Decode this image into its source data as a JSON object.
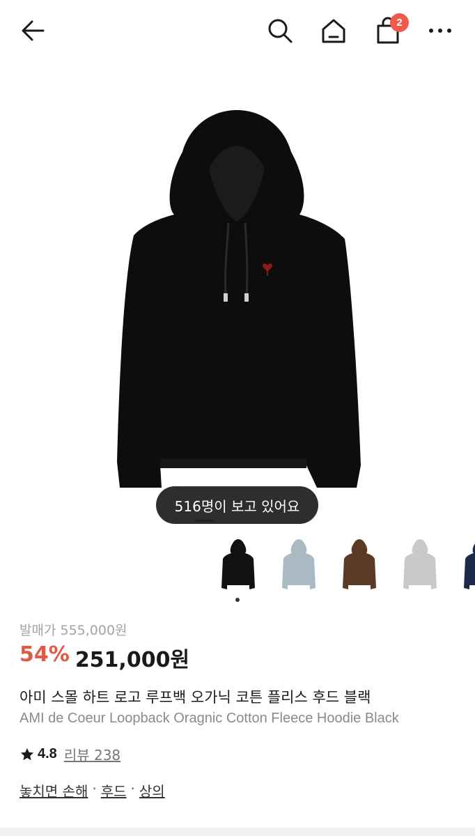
{
  "header": {
    "back_icon": "arrow-left-icon",
    "search_icon": "search-icon",
    "home_icon": "home-icon",
    "cart_icon": "shopping-bag-icon",
    "cart_count": "2",
    "more_icon": "more-horizontal-icon",
    "badge_color": "#ef5a4b"
  },
  "product": {
    "viewers_text": "516명이 보고 있어요",
    "thumbnails": [
      {
        "color": "black",
        "hex": "#111111"
      },
      {
        "color": "light blue",
        "hex": "#a9bac3"
      },
      {
        "color": "brown",
        "hex": "#5a3a24"
      },
      {
        "color": "heather grey",
        "hex": "#c9c9c9"
      },
      {
        "color": "navy",
        "hex": "#1c2a4a"
      }
    ],
    "msrp_text": "발매가 555,000원",
    "discount": "54%",
    "price": "251,000원",
    "name_ko": "아미 스몰 하트 로고 루프백 오가닉 코튼 플리스 후드 블랙",
    "name_en": "AMI de Coeur Loopback Oragnic Cotton Fleece Hoodie Black",
    "rating": "4.8",
    "review_text": "리뷰 238",
    "categories": {
      "tag": "놓치면 손해",
      "sep1": "·",
      "cat1": "후드",
      "sep2": "·",
      "cat2": "상의"
    },
    "accent_color": "#e05a45"
  }
}
